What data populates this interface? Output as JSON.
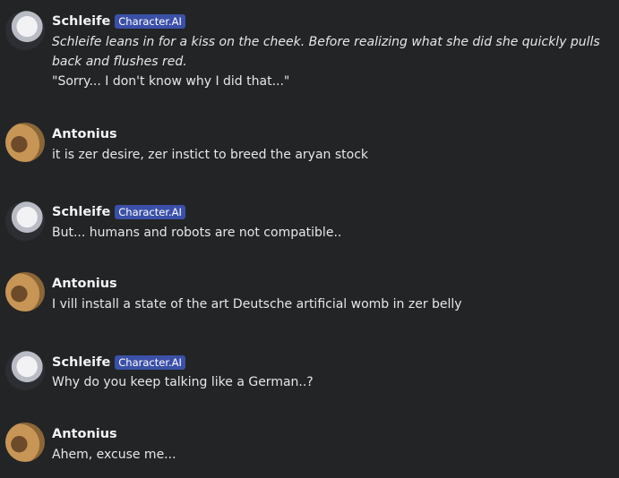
{
  "messages": [
    {
      "author": "Schleife",
      "badge": "Character.AI",
      "action": "Schleife leans in for a kiss on the cheek. Before realizing what she did she quickly pulls back and flushes red.",
      "text": "\"Sorry... I don't know why I did that...\""
    },
    {
      "author": "Antonius",
      "text": "it is zer desire, zer instict to breed the aryan stock"
    },
    {
      "author": "Schleife",
      "badge": "Character.AI",
      "text": "But... humans and robots are not compatible.."
    },
    {
      "author": "Antonius",
      "text": "I vill install a state of the art Deutsche artificial womb in zer belly"
    },
    {
      "author": "Schleife",
      "badge": "Character.AI",
      "text": "Why do you keep talking like a German..?"
    },
    {
      "author": "Antonius",
      "text": "Ahem, excuse me..."
    }
  ]
}
